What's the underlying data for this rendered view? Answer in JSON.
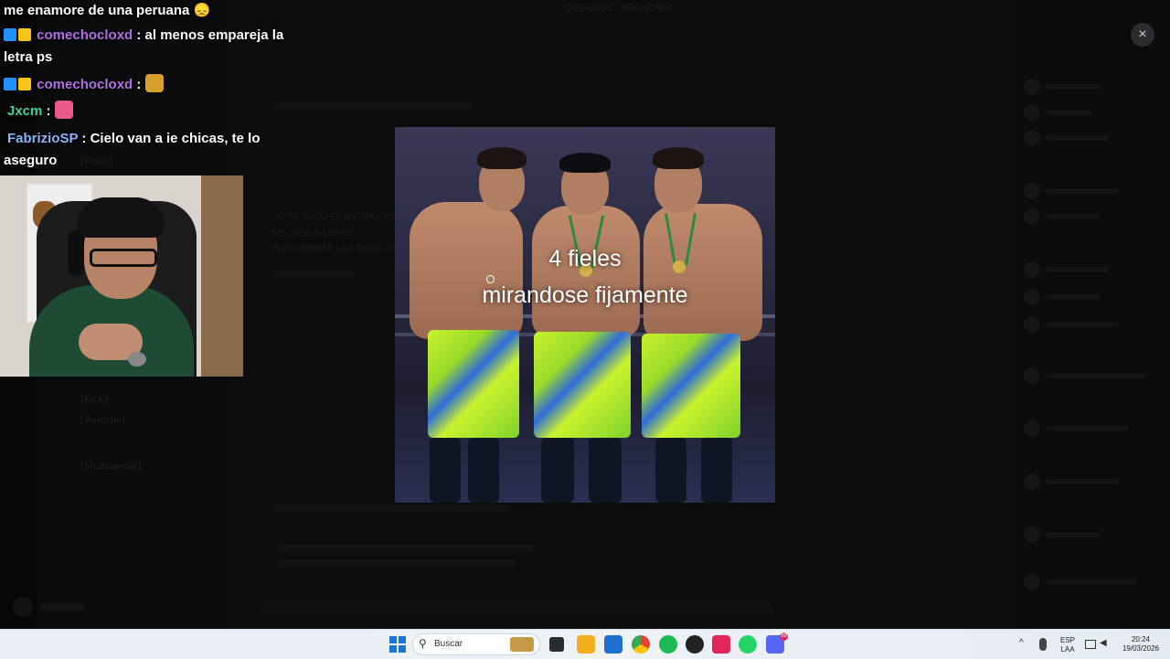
{
  "window": {
    "title": "QUERIDOS / REGISTRAS"
  },
  "channels": [
    {
      "label": "[Roles]"
    },
    {
      "label": "[Kick]"
    },
    {
      "label": "[Youtube]"
    },
    {
      "label": "[Multimedia]"
    }
  ],
  "background_chat": {
    "lines": [
      "YO TE SACO EL ANTRAX XD",
      "ME DEBES 100 SO",
      "POR ABRIRTE LOS OJOS XD"
    ]
  },
  "image_viewer": {
    "overlay_line1": "4 fieles",
    "overlay_line2": "mirandose fijamente",
    "close_label": "×"
  },
  "chat_overlay": {
    "messages": [
      {
        "user": "",
        "text": "me enamore de una peruana 😞",
        "emote": ""
      },
      {
        "user": "comechocloxd",
        "text": ": al menos empareja la",
        "text2": "letra ps",
        "user_color": "#b16ee6",
        "badges": true
      },
      {
        "user": "comechocloxd",
        "text": ":",
        "emote": "#d6a02a",
        "user_color": "#b16ee6",
        "badges": true
      },
      {
        "user": "Jxcm",
        "text": ":",
        "emote": "#e85a8b",
        "user_color": "#3fd49b",
        "badges": false
      },
      {
        "user": "FabrizioSP",
        "text": ": Cielo van a ie chicas, te lo",
        "text2": "aseguro",
        "user_color": "#8ab4f8",
        "badges": false
      }
    ]
  },
  "taskbar": {
    "search_placeholder": "Buscar",
    "language_line1": "ESP",
    "language_line2": "LAA",
    "time": "20:24",
    "date": "19/03/2026",
    "discord_badge": "99"
  },
  "colors": {
    "accent": "#5865f2",
    "shorts_yellow": "#c9f22e",
    "shorts_blue": "#2f6bd8"
  }
}
